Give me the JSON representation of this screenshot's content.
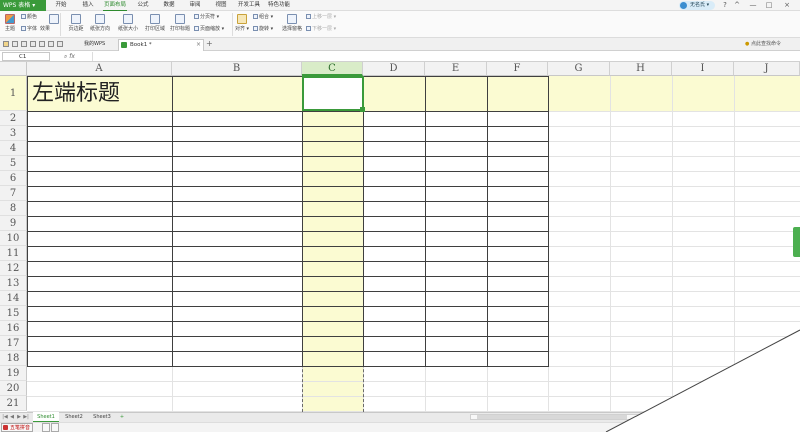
{
  "app": {
    "name": "WPS 表格"
  },
  "menu": [
    "开始",
    "插入",
    "页面布局",
    "公式",
    "数据",
    "审阅",
    "视图",
    "开发工具",
    "特色功能"
  ],
  "menu_active_index": 2,
  "user": {
    "name": "无名氏"
  },
  "window_controls": [
    "?",
    "^",
    "—",
    "□",
    "×"
  ],
  "ribbon": {
    "theme": "主题",
    "theme_colors": "颜色",
    "theme_fonts": "字体",
    "theme_effects": "效果",
    "margins": "页边距",
    "orientation": "纸张方向",
    "size": "纸张大小",
    "print_area": "打印区域",
    "print_titles": "打印标题",
    "page_break": "分页符",
    "page_zoom": "页面缩放",
    "align": "对齐",
    "group": "组合",
    "rotate": "旋转",
    "selection_pane": "选择窗格",
    "bring_forward": "上移一层",
    "send_backward": "下移一层"
  },
  "tabs": {
    "my_wps": "我的WPS",
    "book": "Book1 *",
    "close": "×",
    "add": "+"
  },
  "command_search": "点此查找命令 (Alt+Q)",
  "formula": {
    "namebox": "C1",
    "fx": "fx",
    "value": ""
  },
  "columns": [
    "A",
    "B",
    "C",
    "D",
    "E",
    "F",
    "G",
    "H",
    "I",
    "J"
  ],
  "selected_column": "C",
  "rows": [
    "1",
    "2",
    "3",
    "4",
    "5",
    "6",
    "7",
    "8",
    "9",
    "10",
    "11",
    "12",
    "13",
    "14",
    "15",
    "16",
    "17",
    "18",
    "19",
    "20",
    "21"
  ],
  "cells": {
    "A1": "左端标题"
  },
  "sheets": [
    "Sheet1",
    "Sheet2",
    "Sheet3"
  ],
  "sheet_nav": [
    "|◀",
    "◀",
    "▶",
    "▶|"
  ],
  "sheet_add": "+",
  "ime": {
    "label": "五笔拼音"
  },
  "colors": {
    "accent": "#3a9a3a",
    "highlight": "#fbfbd2",
    "border": "#3f3f3f"
  }
}
